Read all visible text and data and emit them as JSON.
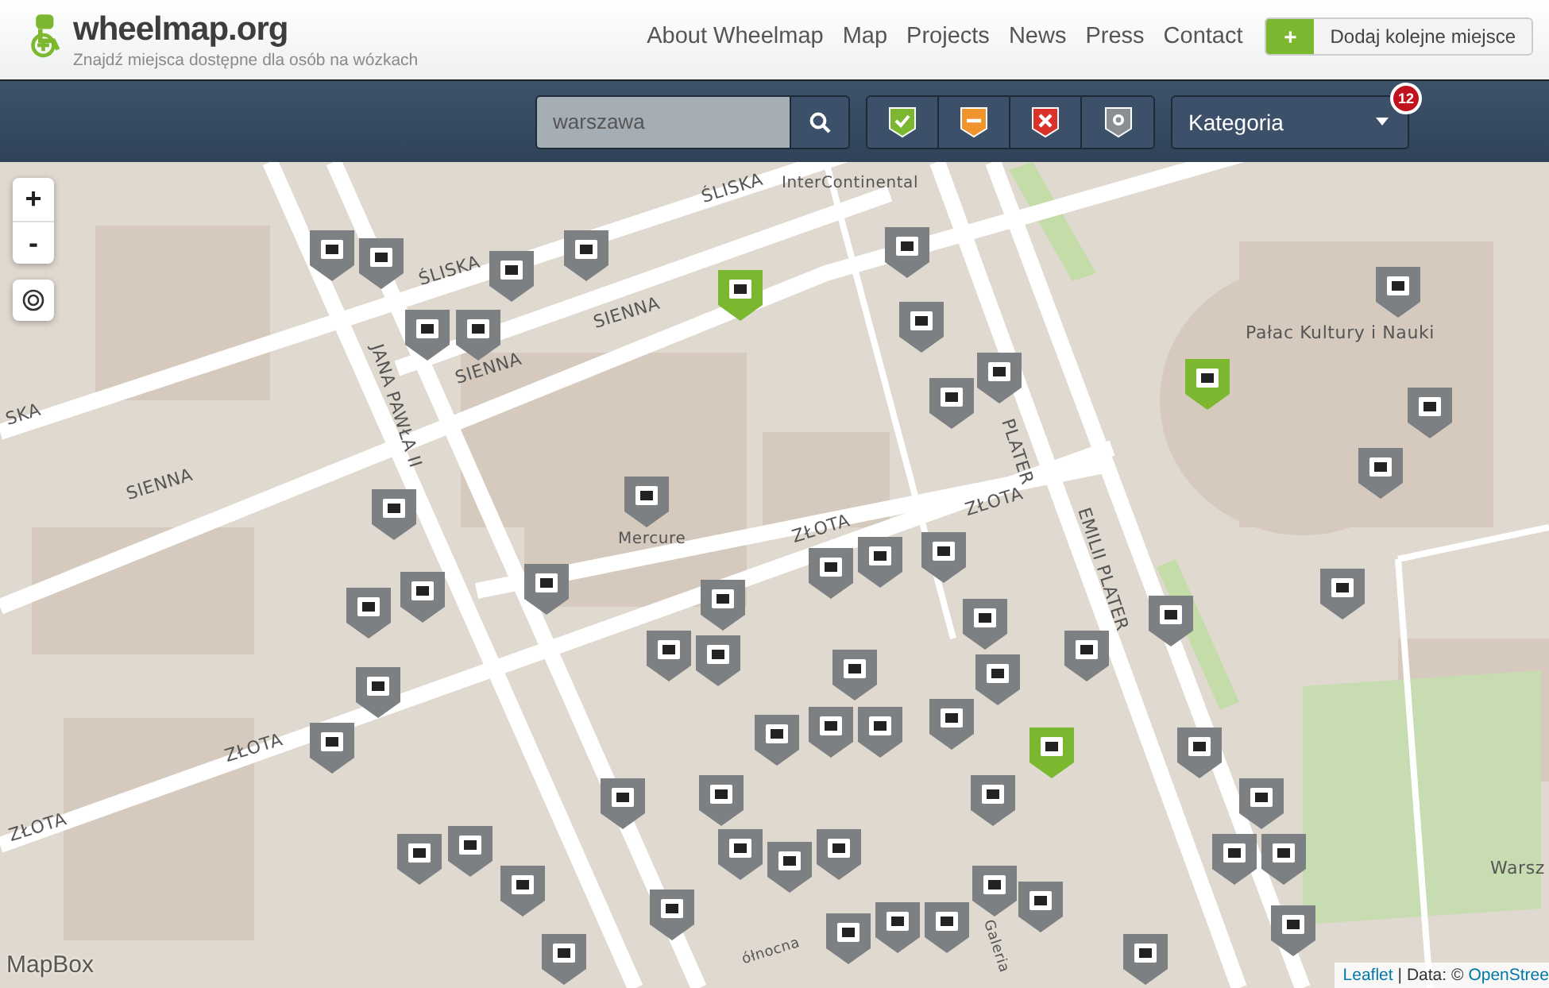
{
  "header": {
    "logo_text": "wheelmap.org",
    "tagline": "Znajdź miejsca dostępne dla osób na wózkach",
    "nav": [
      "About Wheelmap",
      "Map",
      "Projects",
      "News",
      "Press",
      "Contact"
    ],
    "add_button": {
      "icon": "+",
      "label": "Dodaj kolejne miejsce"
    }
  },
  "toolbar": {
    "search": {
      "value": "warszawa"
    },
    "filters": [
      {
        "kind": "yes",
        "selected": true
      },
      {
        "kind": "limited",
        "selected": true
      },
      {
        "kind": "no",
        "selected": true
      },
      {
        "kind": "unknown",
        "selected": true
      }
    ],
    "category": {
      "label": "Kategoria",
      "badge": "12"
    }
  },
  "map": {
    "zoom_in": "+",
    "zoom_out": "-",
    "labels": [
      "ŚLISKA",
      "ŚLISKA",
      "SIENNA",
      "SIENNA",
      "SIENNA",
      "SKA",
      "JANA PAWŁA II",
      "InterContinental",
      "Mercure",
      "ZŁOTA",
      "ZŁOTA",
      "ZŁOTA",
      "ZŁOTA",
      "PLATER",
      "EMILII PLATER",
      "Pałac Kultury i Nauki",
      "Warsz",
      "ółnocna",
      "Galeria"
    ],
    "markers": [
      {
        "color": "#7d8082"
      },
      {
        "color": "#7d8082"
      },
      {
        "color": "#7d8082"
      },
      {
        "color": "#7d8082"
      },
      {
        "color": "#7d8082"
      },
      {
        "color": "#7d8082"
      },
      {
        "color": "#7d8082"
      },
      {
        "color": "#7d8082"
      },
      {
        "color": "#7d8082"
      },
      {
        "color": "#7d8082"
      },
      {
        "color": "#7d8082"
      },
      {
        "color": "#7d8082"
      },
      {
        "color": "#7d8082"
      },
      {
        "color": "#7d8082"
      },
      {
        "color": "#7d8082"
      },
      {
        "color": "#7d8082"
      },
      {
        "color": "#7d8082"
      },
      {
        "color": "#7d8082"
      },
      {
        "color": "#7d8082"
      },
      {
        "color": "#7d8082"
      },
      {
        "color": "#7d8082"
      },
      {
        "color": "#7d8082"
      },
      {
        "color": "#7d8082"
      },
      {
        "color": "#7d8082"
      },
      {
        "color": "#7d8082"
      },
      {
        "color": "#7d8082"
      },
      {
        "color": "#7d8082"
      },
      {
        "color": "#7d8082"
      },
      {
        "color": "#7d8082"
      },
      {
        "color": "#7d8082"
      },
      {
        "color": "#7d8082"
      },
      {
        "color": "#7d8082"
      },
      {
        "color": "#7d8082"
      },
      {
        "color": "#7d8082"
      },
      {
        "color": "#7d8082"
      },
      {
        "color": "#7d8082"
      },
      {
        "color": "#7d8082"
      },
      {
        "color": "#7d8082"
      },
      {
        "color": "#7d8082"
      },
      {
        "color": "#7d8082"
      },
      {
        "color": "#7d8082"
      },
      {
        "color": "#7d8082"
      },
      {
        "color": "#7d8082"
      },
      {
        "color": "#7d8082"
      },
      {
        "color": "#7d8082"
      },
      {
        "color": "#7d8082"
      },
      {
        "color": "#7d8082"
      },
      {
        "color": "#7d8082"
      },
      {
        "color": "#7d8082"
      },
      {
        "color": "#7d8082"
      },
      {
        "color": "#7d8082"
      },
      {
        "color": "#7d8082"
      },
      {
        "color": "#7d8082"
      },
      {
        "color": "#7d8082"
      },
      {
        "color": "#7d8082"
      },
      {
        "color": "#7d8082"
      },
      {
        "color": "#7d8082"
      },
      {
        "color": "#7d8082"
      },
      {
        "color": "#7cb82f"
      },
      {
        "color": "#7cb82f"
      },
      {
        "color": "#7cb82f"
      }
    ],
    "watermark": "MapBox",
    "attribution": {
      "link": "Leaflet",
      "text": "| Data: ©",
      "source": "OpenStree"
    }
  }
}
